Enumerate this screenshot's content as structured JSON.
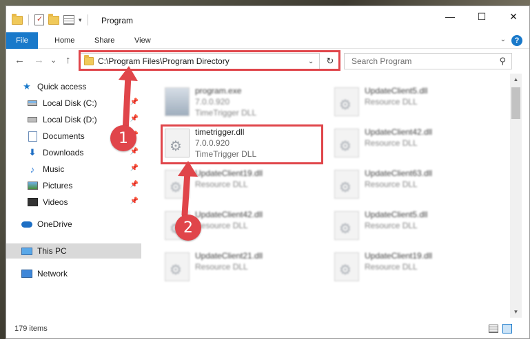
{
  "window": {
    "title": "Program",
    "controls": {
      "minimize": "—",
      "maximize": "☐",
      "close": "✕"
    }
  },
  "ribbon": {
    "tabs": [
      {
        "label": "File"
      },
      {
        "label": "Home"
      },
      {
        "label": "Share"
      },
      {
        "label": "View"
      }
    ],
    "help": "?"
  },
  "nav": {
    "back": "←",
    "forward": "→",
    "recent": "⌄",
    "up": "↑",
    "address": "C:\\Program Files\\Program Directory",
    "refresh": "↻",
    "search_placeholder": "Search Program"
  },
  "sidebar": {
    "items": [
      {
        "label": "Quick access",
        "icon": "star-icon"
      },
      {
        "label": "Local Disk (C:)",
        "icon": "disk-icon",
        "pinned": true
      },
      {
        "label": "Local Disk (D:)",
        "icon": "disk-icon",
        "pinned": true
      },
      {
        "label": "Documents",
        "icon": "documents-icon",
        "pinned": true
      },
      {
        "label": "Downloads",
        "icon": "download-icon",
        "pinned": true
      },
      {
        "label": "Music",
        "icon": "music-icon",
        "pinned": true
      },
      {
        "label": "Pictures",
        "icon": "pictures-icon",
        "pinned": true
      },
      {
        "label": "Videos",
        "icon": "videos-icon",
        "pinned": true
      },
      {
        "label": "OneDrive",
        "icon": "cloud-icon"
      },
      {
        "label": "This PC",
        "icon": "computer-icon",
        "selected": true
      },
      {
        "label": "Network",
        "icon": "network-icon"
      }
    ]
  },
  "files": [
    {
      "name": "program.exe",
      "version": "7.0.0.920",
      "description": "TimeTrigger DLL",
      "icon": "exe-icon"
    },
    {
      "name": "UpdateClient5.dll",
      "version": "",
      "description": "Resource DLL",
      "icon": "dll-icon"
    },
    {
      "name": "timetrigger.dll",
      "version": "7.0.0.920",
      "description": "TimeTrigger DLL",
      "icon": "dll-icon"
    },
    {
      "name": "UpdateClient42.dll",
      "version": "",
      "description": "Resource DLL",
      "icon": "dll-icon"
    },
    {
      "name": "UpdateClient19.dll",
      "version": "",
      "description": "Resource DLL",
      "icon": "dll-icon"
    },
    {
      "name": "UpdateClient63.dll",
      "version": "",
      "description": "Resource DLL",
      "icon": "dll-icon"
    },
    {
      "name": "UpdateClient42.dll",
      "version": "",
      "description": "Resource DLL",
      "icon": "dll-icon"
    },
    {
      "name": "UpdateClient5.dll",
      "version": "",
      "description": "Resource DLL",
      "icon": "dll-icon"
    },
    {
      "name": "UpdateClient21.dll",
      "version": "",
      "description": "Resource DLL",
      "icon": "dll-icon"
    },
    {
      "name": "UpdateClient19.dll",
      "version": "",
      "description": "Resource DLL",
      "icon": "dll-icon"
    }
  ],
  "status": {
    "count": "179 items"
  },
  "callouts": {
    "one": "1",
    "two": "2"
  },
  "colors": {
    "accent": "#1979ca",
    "highlight": "#e0454a",
    "selected": "#d9d9d9"
  }
}
